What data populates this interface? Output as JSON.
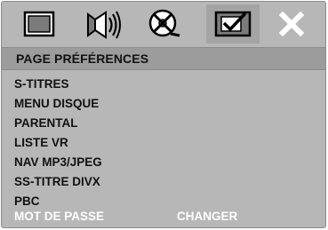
{
  "tabs": [
    {
      "icon": "general-setup-icon",
      "active": false
    },
    {
      "icon": "audio-setup-icon",
      "active": false
    },
    {
      "icon": "video-setup-icon",
      "active": false
    },
    {
      "icon": "preferences-setup-icon",
      "active": true
    },
    {
      "icon": "exit-icon",
      "active": false
    }
  ],
  "header": {
    "title": "PAGE PRÉFÉRENCES"
  },
  "menu": {
    "items": [
      {
        "label": "S-TITRES"
      },
      {
        "label": "MENU DISQUE"
      },
      {
        "label": "PARENTAL"
      },
      {
        "label": "LISTE VR"
      },
      {
        "label": "NAV MP3/JPEG"
      },
      {
        "label": "SS-TITRE DIVX"
      },
      {
        "label": "PBC"
      },
      {
        "label": "MOT DE PASSE",
        "value": "CHANGER",
        "disabled": true
      }
    ]
  },
  "colors": {
    "background": "#b7b7b7",
    "header": "#9c9c9c",
    "text": "#111111",
    "disabled_text": "#ffffff"
  }
}
